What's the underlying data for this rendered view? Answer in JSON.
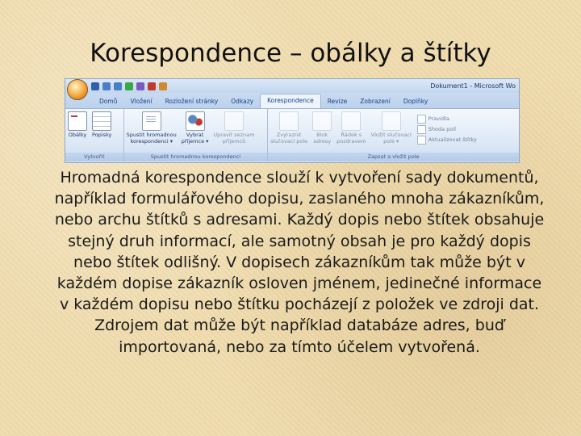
{
  "slide": {
    "title": "Korespondence – obálky a štítky",
    "body": "Hromadná korespondence slouží k vytvoření sady dokumentů, například formulářového dopisu, zaslaného mnoha zákazníkům, nebo archu štítků s adresami. Každý dopis nebo štítek obsahuje stejný druh informací, ale samotný obsah je pro každý dopis nebo štítek odlišný. V dopisech zákazníkům tak může být v každém dopise zákazník osloven jménem, jedinečné informace v každém dopisu nebo štítku pocházejí z položek ve zdroji dat. Zdrojem dat může být například databáze adres, buď importovaná, nebo za tímto účelem vytvořená."
  },
  "ribbon": {
    "window_title": "Dokument1 - Microsoft Wo",
    "tabs": [
      "Domů",
      "Vložení",
      "Rozložení stránky",
      "Odkazy",
      "Korespondence",
      "Revize",
      "Zobrazení",
      "Doplňky"
    ],
    "groups": {
      "create": {
        "label": "Vytvořit",
        "envelopes": "Obálky",
        "labels": "Popisky"
      },
      "start_merge": {
        "label": "Spustit hromadnou korespondenci",
        "start_line1": "Spustit hromadnou",
        "start_line2": "korespondenci ▾",
        "select_line1": "Vybrat",
        "select_line2": "příjemce ▾",
        "edit_line1": "Upravit seznam",
        "edit_line2": "příjemců"
      },
      "write_insert": {
        "label": "Zapsat a vložit pole",
        "highlight_line1": "Zvýraznit",
        "highlight_line2": "slučovací pole",
        "block_line1": "Blok",
        "block_line2": "adresy",
        "greeting_line1": "Řádek s",
        "greeting_line2": "pozdravem",
        "insert_line1": "Vložit slučovací",
        "insert_line2": "pole ▾",
        "rules": "Pravidla",
        "match": "Shoda polí",
        "update": "Aktualizovat štítky"
      }
    }
  },
  "colors": {
    "background": "#efdcae",
    "ribbon_tab_text": "#15428b",
    "ribbon_bg": "#d9e6f5"
  }
}
